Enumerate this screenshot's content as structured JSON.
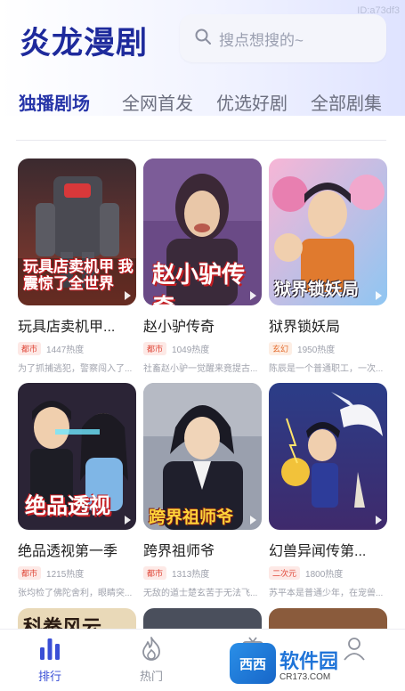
{
  "app_id": "ID:a73df3",
  "header": {
    "title": "炎龙漫剧",
    "search_placeholder": "搜点想搜的~"
  },
  "tabs": [
    {
      "label": "独播剧场",
      "active": true
    },
    {
      "label": "全网首发",
      "active": false
    },
    {
      "label": "优选好剧",
      "active": false
    },
    {
      "label": "全部剧集",
      "active": false
    }
  ],
  "dramas": [
    {
      "title": "玩具店卖机甲...",
      "tag": "都市",
      "heat": "1447热度",
      "desc": "为了抓捕逃犯，警察闯入了...",
      "poster_text": "玩具店卖机甲 我震惊了全世界"
    },
    {
      "title": "赵小驴传奇",
      "tag": "都市",
      "heat": "1049热度",
      "desc": "社畜赵小驴一觉醒来竟提古...",
      "poster_text": "赵小驴传奇"
    },
    {
      "title": "狱界锁妖局",
      "tag": "玄幻",
      "heat": "1950热度",
      "desc": "陈辰是一个普通职工，一次...",
      "poster_text": "狱界锁妖局"
    },
    {
      "title": "绝品透视第一季",
      "tag": "都市",
      "heat": "1215热度",
      "desc": "张均检了佛陀舍利，眼睛突...",
      "poster_text": "绝品透视"
    },
    {
      "title": "跨界祖师爷",
      "tag": "都市",
      "heat": "1313热度",
      "desc": "无敌的道士楚玄苦于无法飞...",
      "poster_text": "跨界祖师爷"
    },
    {
      "title": "幻兽异闻传第...",
      "tag": "二次元",
      "heat": "1800热度",
      "desc": "苏平本是普通少年，在宠兽...",
      "poster_text": ""
    }
  ],
  "peek_poster_text": "科拳风云",
  "bottom_nav": [
    {
      "label": "排行",
      "icon": "bar-chart-icon",
      "active": true
    },
    {
      "label": "热门",
      "icon": "flame-icon",
      "active": false
    },
    {
      "label": "",
      "icon": "tv-icon",
      "active": false
    },
    {
      "label": "",
      "icon": "user-icon",
      "active": false
    }
  ],
  "site_watermark": {
    "badge": "西西",
    "name": "软件园",
    "url": "CR173.COM"
  },
  "colors": {
    "accent": "#2634a8",
    "tab_inactive": "#6d7080",
    "tag_red": "#e0483a",
    "nav_active": "#3a4fd6"
  }
}
